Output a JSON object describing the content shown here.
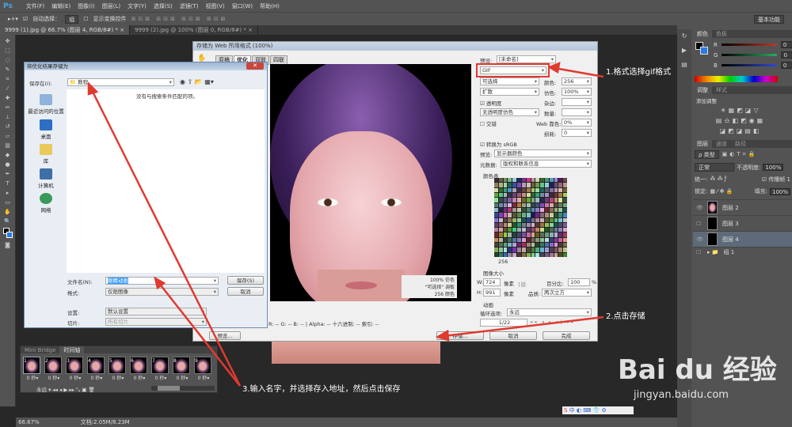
{
  "menubar": {
    "logo": "Ps",
    "items": [
      "文件(F)",
      "编辑(E)",
      "图像(I)",
      "图层(L)",
      "文字(Y)",
      "选择(S)",
      "滤镜(T)",
      "视图(V)",
      "窗口(W)",
      "帮助(H)"
    ]
  },
  "options": {
    "auto_select": "自动选择：",
    "auto_select_value": "组",
    "show_transform": "显示变换控件",
    "workspace": "基本功能"
  },
  "tabs": [
    "9999 (1).jpg @ 66.7% (图层 4, RGB/8#) * ×",
    "9999 (2).jpg @ 100% (图层 0, RGB/8#) * ×"
  ],
  "status": {
    "zoom": "66.67%",
    "doc": "文档:2.05M/8.23M"
  },
  "color_panel": {
    "tabs": [
      "颜色",
      "色板"
    ],
    "channels": [
      {
        "label": "R",
        "value": "0",
        "color": "#c0392b"
      },
      {
        "label": "G",
        "value": "0",
        "color": "#27ae60"
      },
      {
        "label": "B",
        "value": "0",
        "color": "#2e4bd1"
      }
    ]
  },
  "adjust_panel": {
    "tabs": [
      "调整",
      "样式"
    ],
    "title": "添加调整"
  },
  "layers_panel": {
    "tabs": [
      "图层",
      "通道",
      "路径"
    ],
    "kind": "ρ 类型",
    "blend": "正常",
    "opacity_label": "不透明度:",
    "opacity": "100%",
    "unify": "统一:",
    "propagate": "传播帧 1",
    "lock": "锁定:",
    "fill_label": "填充:",
    "fill": "100%",
    "layers": [
      {
        "name": "图层 2",
        "visible": true
      },
      {
        "name": "图层 3",
        "visible": false
      },
      {
        "name": "图层 4",
        "visible": true,
        "selected": true
      },
      {
        "name": "组 1",
        "visible": false,
        "group": true
      }
    ]
  },
  "sfw": {
    "title": "存储为 Web 所用格式 (100%)",
    "view_tabs": [
      "原稿",
      "优化",
      "双联",
      "四联"
    ],
    "preset_label": "预设:",
    "preset": "[未命名]",
    "format": "GIF",
    "reduction": "可选择",
    "dither_algo": "扩散",
    "transparency": "透明度",
    "matte_dither": "无透明度仿色",
    "interlaced": "交错",
    "colors_label": "颜色:",
    "colors": "256",
    "dither_label": "仿色:",
    "dither": "100%",
    "matte_label": "杂边:",
    "amount_label": "数量:",
    "websnap_label": "Web 靠色:",
    "websnap": "0%",
    "lossy_label": "损耗:",
    "lossy": "0",
    "srgb": "转换为 sRGB",
    "preview_label": "预览:",
    "preview": "显示器颜色",
    "metadata_label": "元数据:",
    "metadata": "版权和联系信息",
    "color_table": "颜色表",
    "color_count": "256",
    "image_size": "图像大小",
    "w_label": "W:",
    "w": "724",
    "h_label": "H:",
    "h": "991",
    "unit": "像素",
    "percent_label": "百分比:",
    "percent": "100",
    "pct": "%",
    "quality_label": "品质:",
    "quality": "两次立方",
    "animation": "动画",
    "loop_label": "循环选项:",
    "loop": "永远",
    "frame": "1/22",
    "info": [
      "100% 仿色",
      "\"可选择\" 调板",
      "256 颜色"
    ],
    "readout": "R: --   G: --   B: --   |   Alpha: --   十六进制: --   索引: --",
    "preview_btn": "预览...",
    "save": "存储...",
    "cancel": "取消",
    "done": "完成"
  },
  "save_dialog": {
    "title": "将优化结果存储为",
    "save_in_label": "保存在(I):",
    "folder": "教程",
    "empty_msg": "没有与搜索条件匹配的项。",
    "places": [
      "最近访问的位置",
      "桌面",
      "库",
      "计算机",
      "网络"
    ],
    "filename_label": "文件名(N):",
    "filename": "眼睛动画",
    "format_label": "格式:",
    "format": "仅限图像",
    "settings_label": "设置:",
    "settings": "默认设置",
    "slices_label": "切片:",
    "slices": "所有切片",
    "save": "保存(S)",
    "cancel": "取消"
  },
  "timeline": {
    "tabs": [
      "Mini Bridge",
      "时间轴"
    ],
    "frames": [
      "1",
      "2",
      "3",
      "4",
      "5",
      "6",
      "7",
      "8",
      "9"
    ],
    "delay": "0 秒▾",
    "loop": "永远"
  },
  "annotations": [
    "1.格式选择gif格式",
    "2.点击存储",
    "3.输入名字，并选择存入地址，然后点击保存"
  ],
  "watermark": {
    "brand": "Bai du 经验",
    "url": "jingyan.baidu.com"
  },
  "colors": {
    "arrow": "#e03a30",
    "accent": "#4fa3e0"
  }
}
